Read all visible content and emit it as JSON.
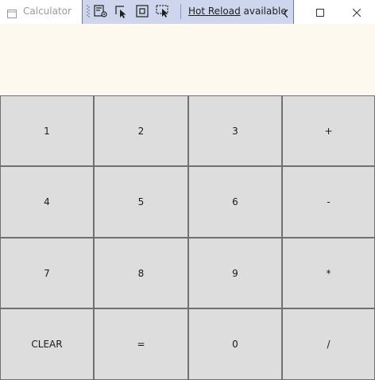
{
  "window": {
    "title": "Calculator",
    "icons": {
      "app": "window-icon",
      "minimize": "minimize-icon",
      "maximize": "maximize-icon",
      "close": "close-icon"
    }
  },
  "dev_toolbar": {
    "hot_reload_link": "Hot Reload",
    "hot_reload_status": " available",
    "icons": [
      "select-element-icon",
      "display-adorners-icon",
      "track-focus-icon",
      "preview-selection-icon",
      "collapse-chevron-icon"
    ],
    "background": "#ced6ee"
  },
  "display": {
    "value": "",
    "background": "#fdf9ee"
  },
  "keypad": {
    "keys": [
      "1",
      "2",
      "3",
      "+",
      "4",
      "5",
      "6",
      "-",
      "7",
      "8",
      "9",
      "*",
      "CLEAR",
      "=",
      "0",
      "/"
    ],
    "key_background": "#dddddd",
    "border_color": "#707070"
  }
}
